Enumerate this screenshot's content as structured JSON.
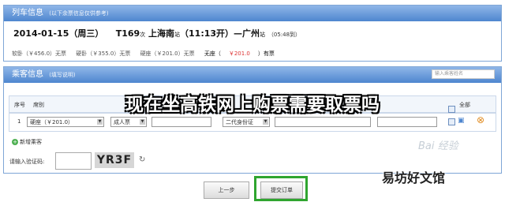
{
  "train_panel": {
    "title": "列车信息",
    "subtitle": "(以下余票信息仅供参考)",
    "date": "2014-01-15（周三）",
    "train_no": "T169",
    "train_suffix": "次",
    "from": "上海南",
    "from_suffix": "站",
    "depart": "（11:13开）",
    "dash": "—",
    "to": "广州",
    "to_suffix": "站",
    "duration": "（05:48到）",
    "fares": [
      {
        "label": "软卧（￥456.0）无票"
      },
      {
        "label": "硬卧（￥355.0）无票"
      },
      {
        "label": "硬座（￥201.0）无票"
      }
    ],
    "standing": "无座（",
    "standing_price": "￥201.0",
    "standing_status": "）有票"
  },
  "passenger_panel": {
    "title": "乘客信息",
    "subtitle": "(填写说明)",
    "search_placeholder": "输入乘客姓名",
    "headers": [
      "序号",
      "席别",
      "全部"
    ],
    "row": {
      "index": "1",
      "seat": "硬座（￥201.0）",
      "ticket_type": "成人票",
      "id_type": "二代身份证"
    },
    "add_passenger": "新增乘客"
  },
  "captcha": {
    "label": "请输入验证码:",
    "code": "YR3F"
  },
  "overlay_title": "现在坐高铁网上购票需要取票吗",
  "watermark": "易坊好文馆",
  "baidu_mark": "Bai 经验",
  "buttons": {
    "prev": "上一步",
    "submit": "提交订单"
  },
  "colors": {
    "panel_header": "#4e86cf",
    "submit_highlight": "#2fa52f",
    "price_red": "#d33333"
  }
}
